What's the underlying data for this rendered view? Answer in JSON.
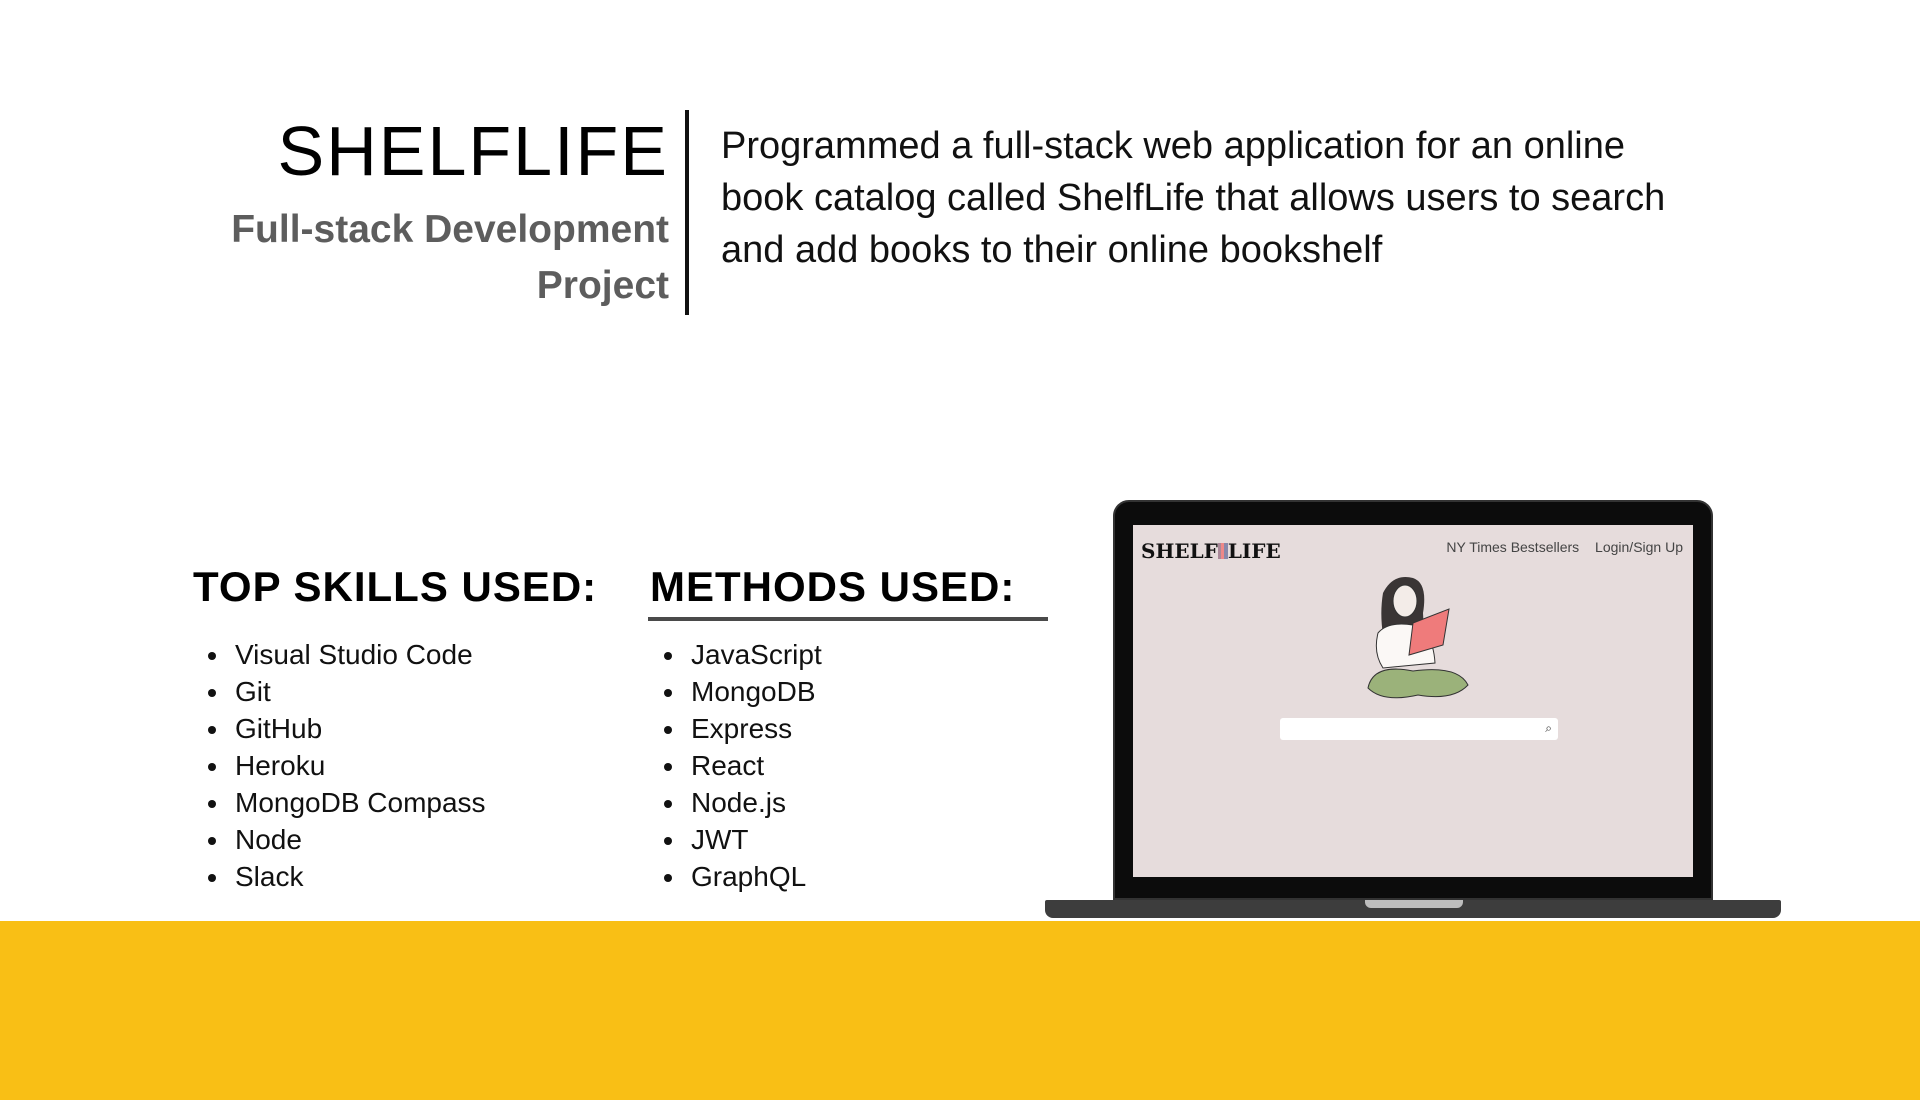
{
  "project": {
    "title": "SHELFLIFE",
    "subtitle_line1": "Full-stack Development",
    "subtitle_line2": "Project",
    "description": "Programmed a full-stack web application for an online book catalog called ShelfLife that allows users to search and add books to their online bookshelf"
  },
  "skills": {
    "heading": "TOP SKILLS USED:",
    "items": [
      "Visual Studio Code",
      "Git",
      "GitHub",
      "Heroku",
      "MongoDB Compass",
      "Node",
      "Slack"
    ]
  },
  "methods": {
    "heading": "METHODS USED:",
    "items": [
      "JavaScript",
      "MongoDB",
      "Express",
      "React",
      "Node.js",
      "JWT",
      "GraphQL"
    ]
  },
  "app_preview": {
    "logo_left": "SHELF",
    "logo_right": "LIFE",
    "nav_bestsellers": "NY Times Bestsellers",
    "nav_login": "Login/Sign Up",
    "search_placeholder": ""
  },
  "colors": {
    "accent_band": "#f9bf15",
    "app_background": "#e6dcdc",
    "book": "#ef7b7b",
    "pants": "#9bb27a"
  }
}
